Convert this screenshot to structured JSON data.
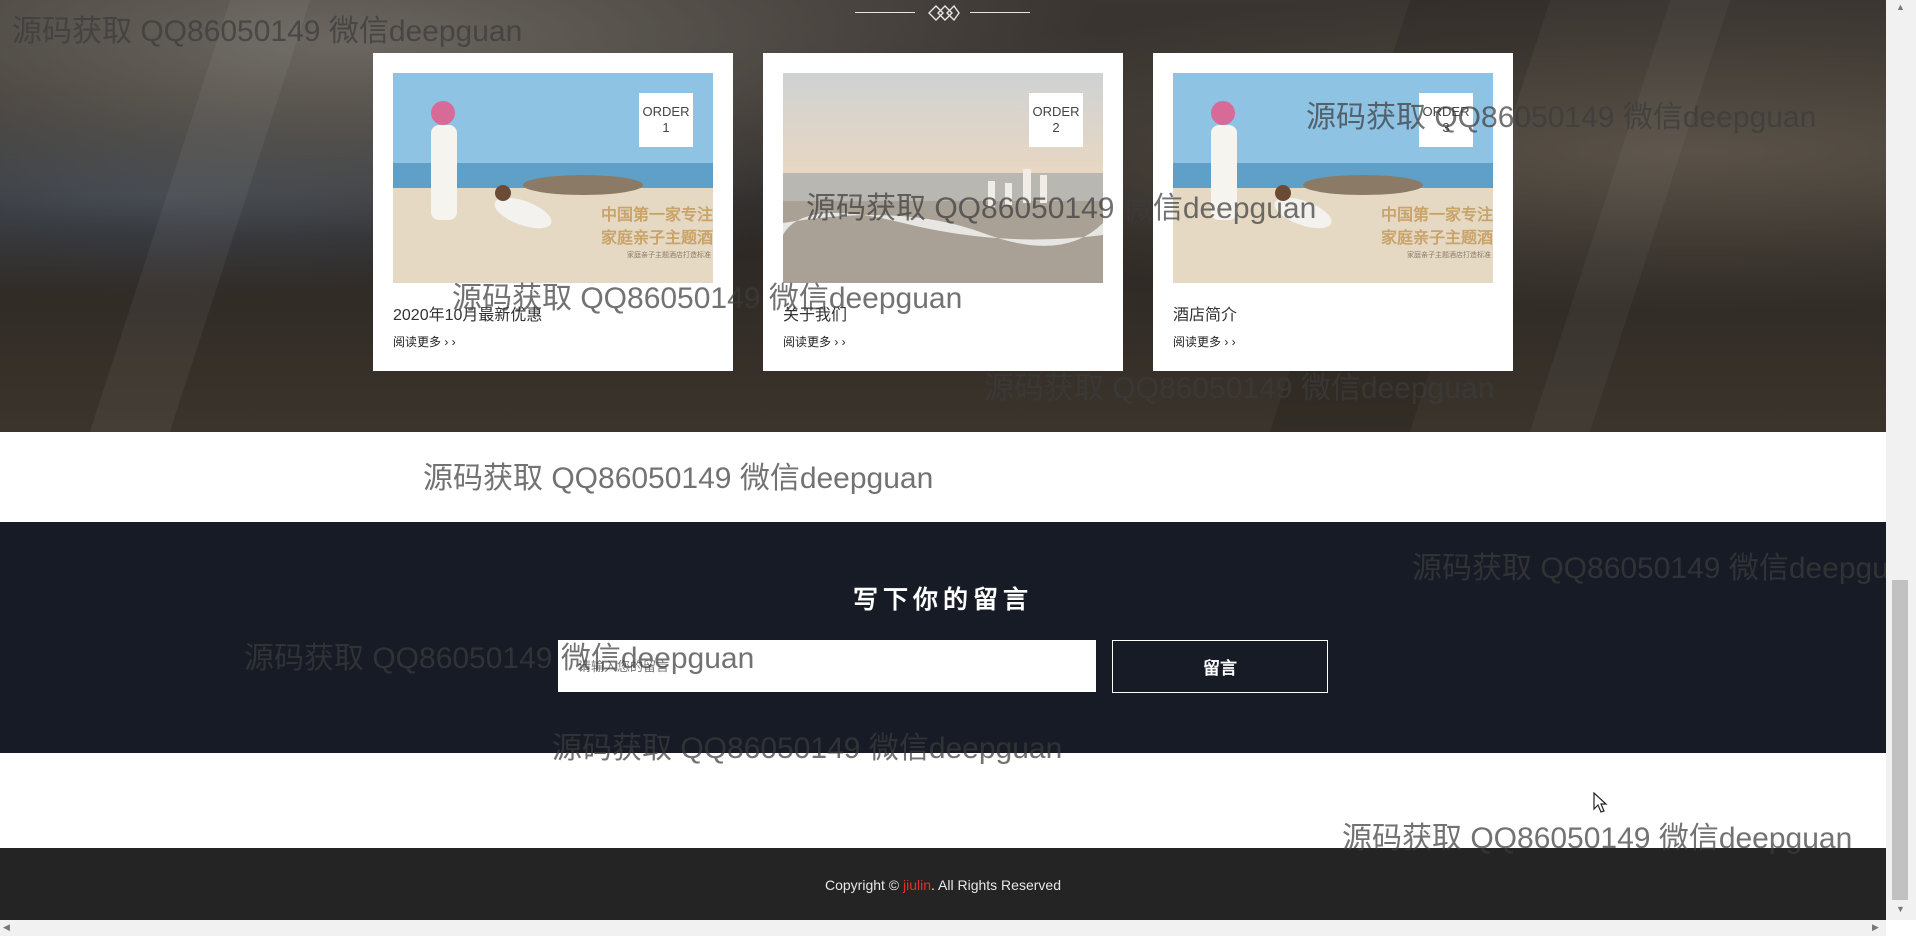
{
  "cards": [
    {
      "order_word": "ORDER",
      "order_num": "1",
      "title": "2020年10月最新优惠",
      "more": "阅读更多 › ›"
    },
    {
      "order_word": "ORDER",
      "order_num": "2",
      "title": "关于我们",
      "more": "阅读更多 › ›"
    },
    {
      "order_word": "ORDER",
      "order_num": "3",
      "title": "酒店简介",
      "more": "阅读更多 › ›"
    }
  ],
  "promo_image": {
    "heading_line1": "中国第一家专注",
    "heading_line2": "家庭亲子主题酒",
    "subline": "家庭亲子主题酒店打造标准"
  },
  "message": {
    "title": "写下你的留言",
    "placeholder": "请输入您的留言",
    "submit_label": "留言"
  },
  "footer": {
    "prefix": "Copyright © ",
    "brand": "jiulin",
    "suffix": ". All Rights Reserved"
  },
  "watermark_text": "源码获取 QQ86050149 微信deepguan",
  "colors": {
    "message_bg": "#161b25",
    "footer_bg": "#242424",
    "brand_red": "#e3312c"
  }
}
